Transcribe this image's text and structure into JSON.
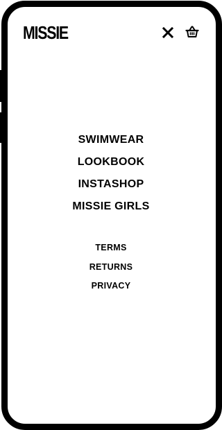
{
  "brand": {
    "logo_text": "MISSIE"
  },
  "header": {
    "close_icon": "close-icon",
    "cart_icon": "basket-icon"
  },
  "main_menu": [
    {
      "label": "SWIMWEAR"
    },
    {
      "label": "LOOKBOOK"
    },
    {
      "label": "INSTASHOP"
    },
    {
      "label": "MISSIE GIRLS"
    }
  ],
  "footer_menu": [
    {
      "label": "TERMS"
    },
    {
      "label": "RETURNS"
    },
    {
      "label": "PRIVACY"
    }
  ],
  "colors": {
    "text": "#000000",
    "background": "#ffffff",
    "frame": "#000000"
  }
}
